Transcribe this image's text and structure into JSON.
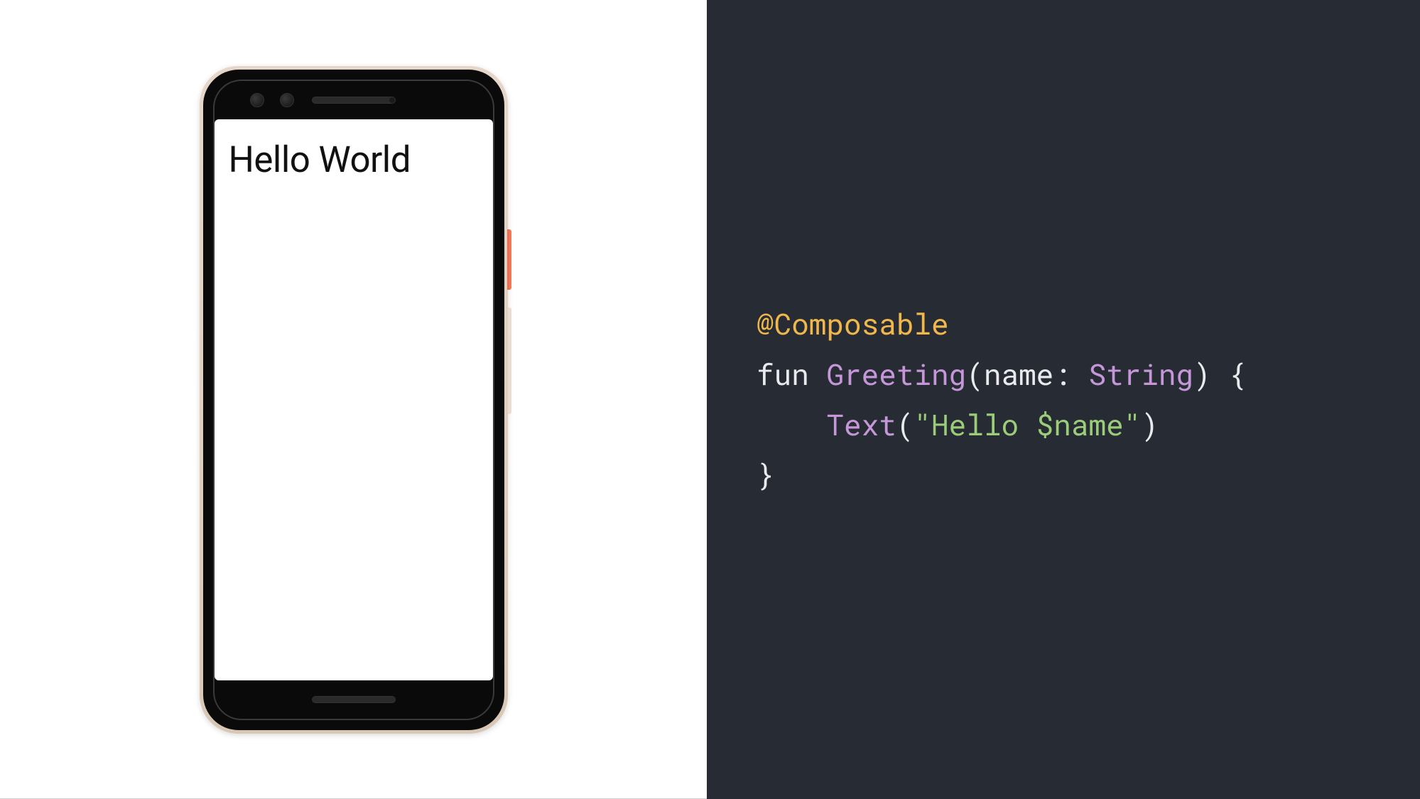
{
  "phone": {
    "screen_text": "Hello World"
  },
  "code": {
    "annotation": "@Composable",
    "keyword_fun": "fun",
    "func_name": "Greeting",
    "paren_open": "(",
    "param_name": "name",
    "colon_sp": ": ",
    "param_type": "String",
    "paren_close": ")",
    "brace_open": " {",
    "indent": "    ",
    "call_name": "Text",
    "call_paren_open": "(",
    "string_literal": "\"Hello $name\"",
    "call_paren_close": ")",
    "brace_close": "}"
  },
  "colors": {
    "code_bg": "#272b33",
    "annotation": "#f0b74c",
    "identifier": "#c597d9",
    "string": "#9bcc7a",
    "default": "#e8eaed"
  }
}
